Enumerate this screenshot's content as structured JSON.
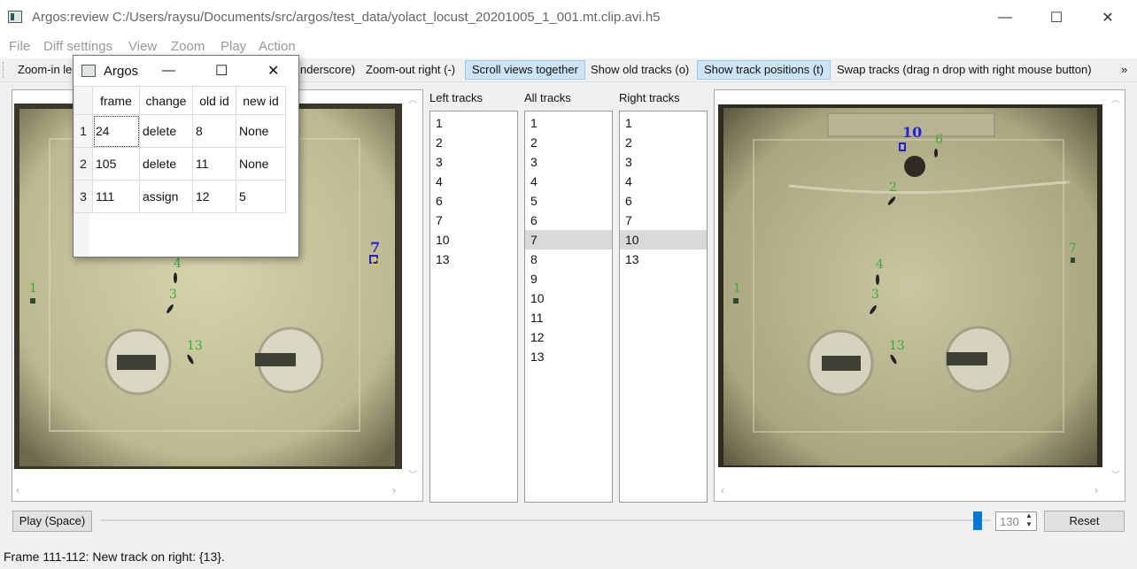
{
  "window": {
    "title": "Argos:review C:/Users/raysu/Documents/src/argos/test_data/yolact_locust_20201005_1_001.mt.clip.avi.h5",
    "minimize_glyph": "—",
    "maximize_glyph": "☐",
    "close_glyph": "✕"
  },
  "menu": [
    "File",
    "Diff settings",
    "View",
    "Zoom",
    "Play",
    "Action"
  ],
  "toolbar": {
    "zoom_in_left": "Zoom-in le",
    "zoom_out_left_tail": "nderscore)",
    "zoom_out_right": "Zoom-out right (-)",
    "scroll_together": "Scroll views together",
    "show_old_tracks": "Show old tracks (o)",
    "show_track_positions": "Show track positions (t)",
    "swap_tracks": "Swap tracks (drag n drop with right mouse button)",
    "overflow": "»"
  },
  "dialog": {
    "title": "Argos",
    "headers": [
      "frame",
      "change",
      "old id",
      "new id"
    ],
    "rows": [
      {
        "n": "1",
        "frame": "24",
        "change": "delete",
        "old_id": "8",
        "new_id": "None"
      },
      {
        "n": "2",
        "frame": "105",
        "change": "delete",
        "old_id": "11",
        "new_id": "None"
      },
      {
        "n": "3",
        "frame": "111",
        "change": "assign",
        "old_id": "12",
        "new_id": "5"
      }
    ]
  },
  "lists": {
    "left_label": "Left tracks",
    "left": [
      "1",
      "2",
      "3",
      "4",
      "6",
      "7",
      "10",
      "13"
    ],
    "all_label": "All tracks",
    "all": [
      "1",
      "2",
      "3",
      "4",
      "5",
      "6",
      "7",
      "8",
      "9",
      "10",
      "11",
      "12",
      "13"
    ],
    "all_selected": "7",
    "right_label": "Right tracks",
    "right": [
      "1",
      "2",
      "3",
      "4",
      "6",
      "7",
      "10",
      "13"
    ],
    "right_selected": "10"
  },
  "left_view": {
    "labels": [
      {
        "id": "7",
        "color": "#2222dd"
      },
      {
        "id": "1",
        "color": "#3aaa3a"
      },
      {
        "id": "4",
        "color": "#3aaa3a"
      },
      {
        "id": "3",
        "color": "#3aaa3a"
      },
      {
        "id": "13",
        "color": "#3aaa3a"
      }
    ]
  },
  "right_view": {
    "labels": [
      {
        "id": "10",
        "color": "#2222dd"
      },
      {
        "id": "6",
        "color": "#3aaa3a"
      },
      {
        "id": "2",
        "color": "#3aaa3a"
      },
      {
        "id": "7",
        "color": "#3aaa3a"
      },
      {
        "id": "1",
        "color": "#3aaa3a"
      },
      {
        "id": "4",
        "color": "#3aaa3a"
      },
      {
        "id": "3",
        "color": "#3aaa3a"
      },
      {
        "id": "13",
        "color": "#3aaa3a"
      }
    ]
  },
  "controls": {
    "play_label": "Play (Space)",
    "frame_value": "130",
    "slider_fraction": 0.99,
    "reset_label": "Reset"
  },
  "status": "Frame 111-112: New track on right: {13}.",
  "colors": {
    "accent": "#0078d7",
    "toggle_on": "#cce4f7",
    "track_new": "#2222dd",
    "track_old": "#3aaa3a"
  }
}
